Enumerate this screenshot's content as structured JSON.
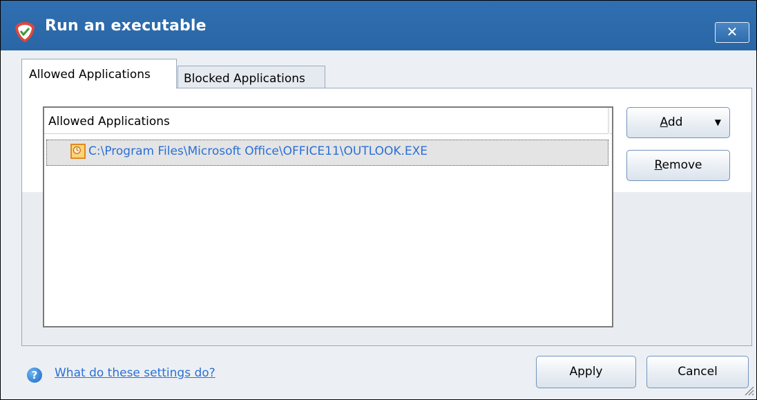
{
  "window": {
    "title": "Run an executable",
    "close_label": "✕"
  },
  "tabs": [
    {
      "label": "Allowed Applications",
      "active": true
    },
    {
      "label": "Blocked Applications",
      "active": false
    }
  ],
  "list": {
    "header": "Allowed Applications",
    "items": [
      {
        "path": "C:\\Program Files\\Microsoft Office\\OFFICE11\\OUTLOOK.EXE",
        "icon": "clock-icon",
        "selected": true
      }
    ]
  },
  "buttons": {
    "add": {
      "prefix": "",
      "accel": "A",
      "rest": "dd"
    },
    "remove": {
      "prefix": "",
      "accel": "R",
      "rest": "emove"
    },
    "apply": "Apply",
    "cancel": "Cancel"
  },
  "help": {
    "icon": "question-icon",
    "glyph": "?",
    "link_text": "What do these settings do?"
  },
  "colors": {
    "titlebar": "#2a66a6",
    "link": "#2a6fd6",
    "item_icon": "#e08a1e"
  }
}
